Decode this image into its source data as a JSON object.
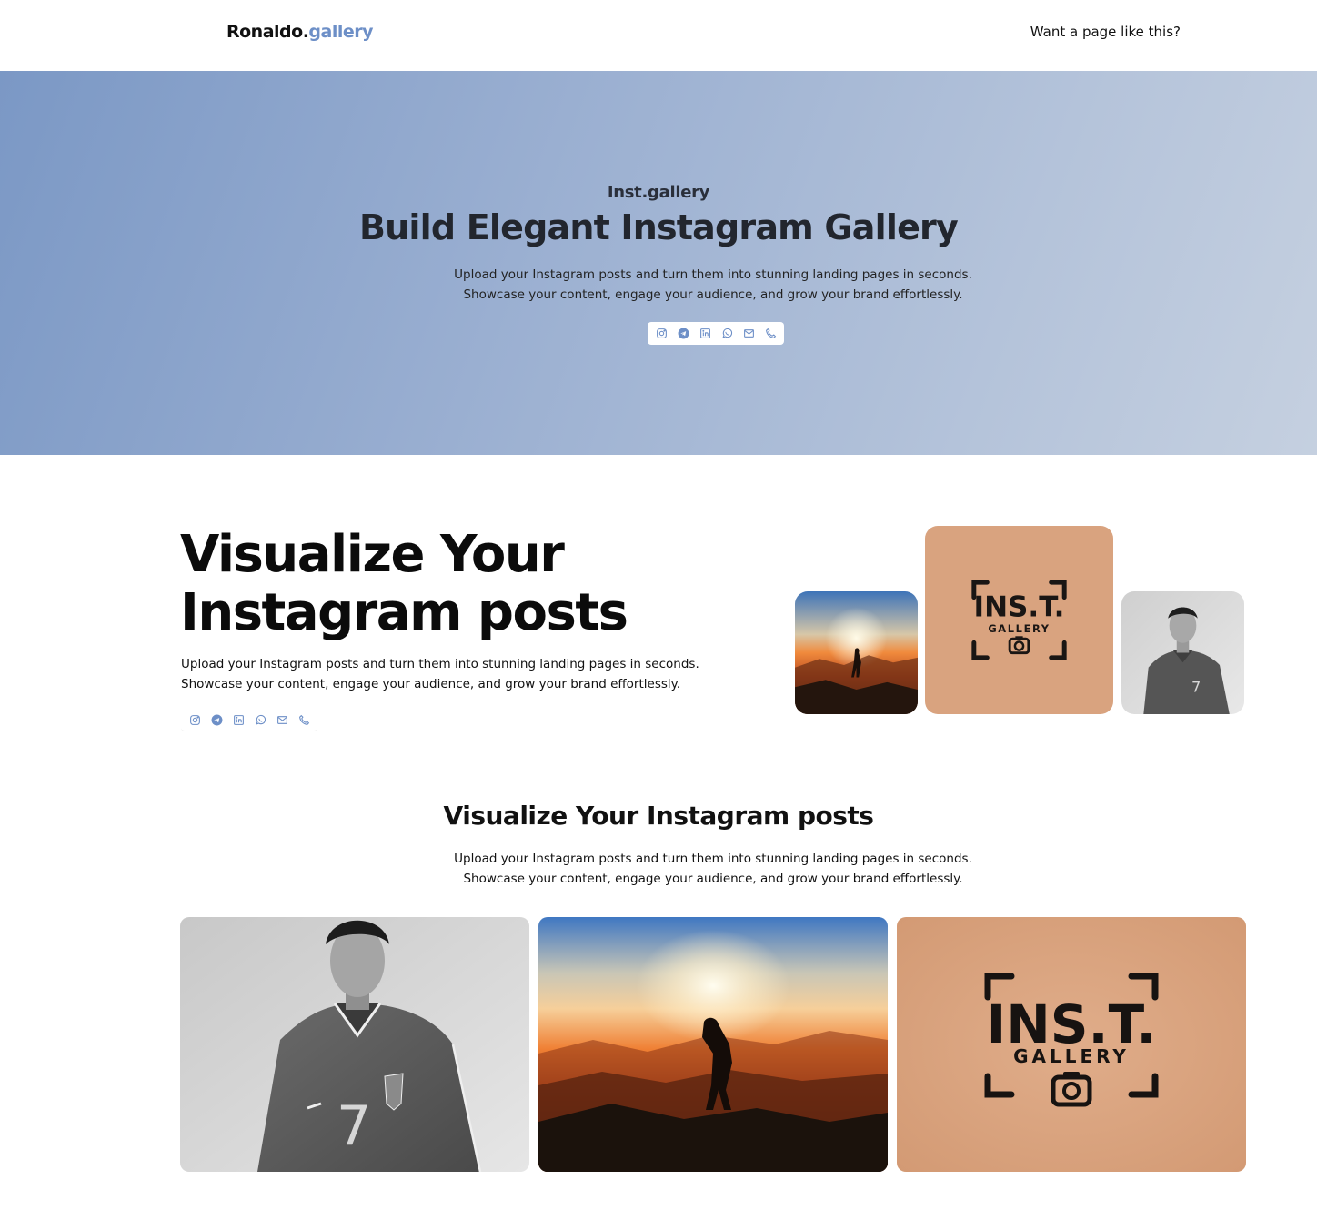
{
  "header": {
    "logo_main": "Ronaldo.",
    "logo_accent": "gallery",
    "cta": "Want a page like this?"
  },
  "hero": {
    "eyebrow": "Inst.gallery",
    "title": "Build Elegant Instagram Gallery",
    "description": "Upload your Instagram posts and turn them into stunning landing pages in seconds. Showcase your content, engage your audience, and grow your brand effortlessly."
  },
  "socials": [
    "instagram-icon",
    "telegram-icon",
    "linkedin-icon",
    "whatsapp-icon",
    "email-icon",
    "phone-icon"
  ],
  "feature": {
    "title": "Visualize Your Instagram posts",
    "description": "Upload your Instagram posts and turn them into stunning landing pages in seconds. Showcase your content, engage your audience, and grow your brand effortlessly."
  },
  "gallery": {
    "title": "Visualize Your Instagram posts",
    "description": "Upload your Instagram posts and turn them into stunning landing pages in seconds. Showcase your content, engage your audience, and grow your brand effortlessly."
  },
  "logo_image": {
    "line1": "INS.T.",
    "line2": "GALLERY"
  },
  "player_image": {
    "jersey_number": "7"
  },
  "colors": {
    "accent": "#6d8fc7",
    "hero_gradient_start": "#7b98c5",
    "hero_gradient_end": "#c5d0e0",
    "logo_tile": "#d9a37f"
  }
}
